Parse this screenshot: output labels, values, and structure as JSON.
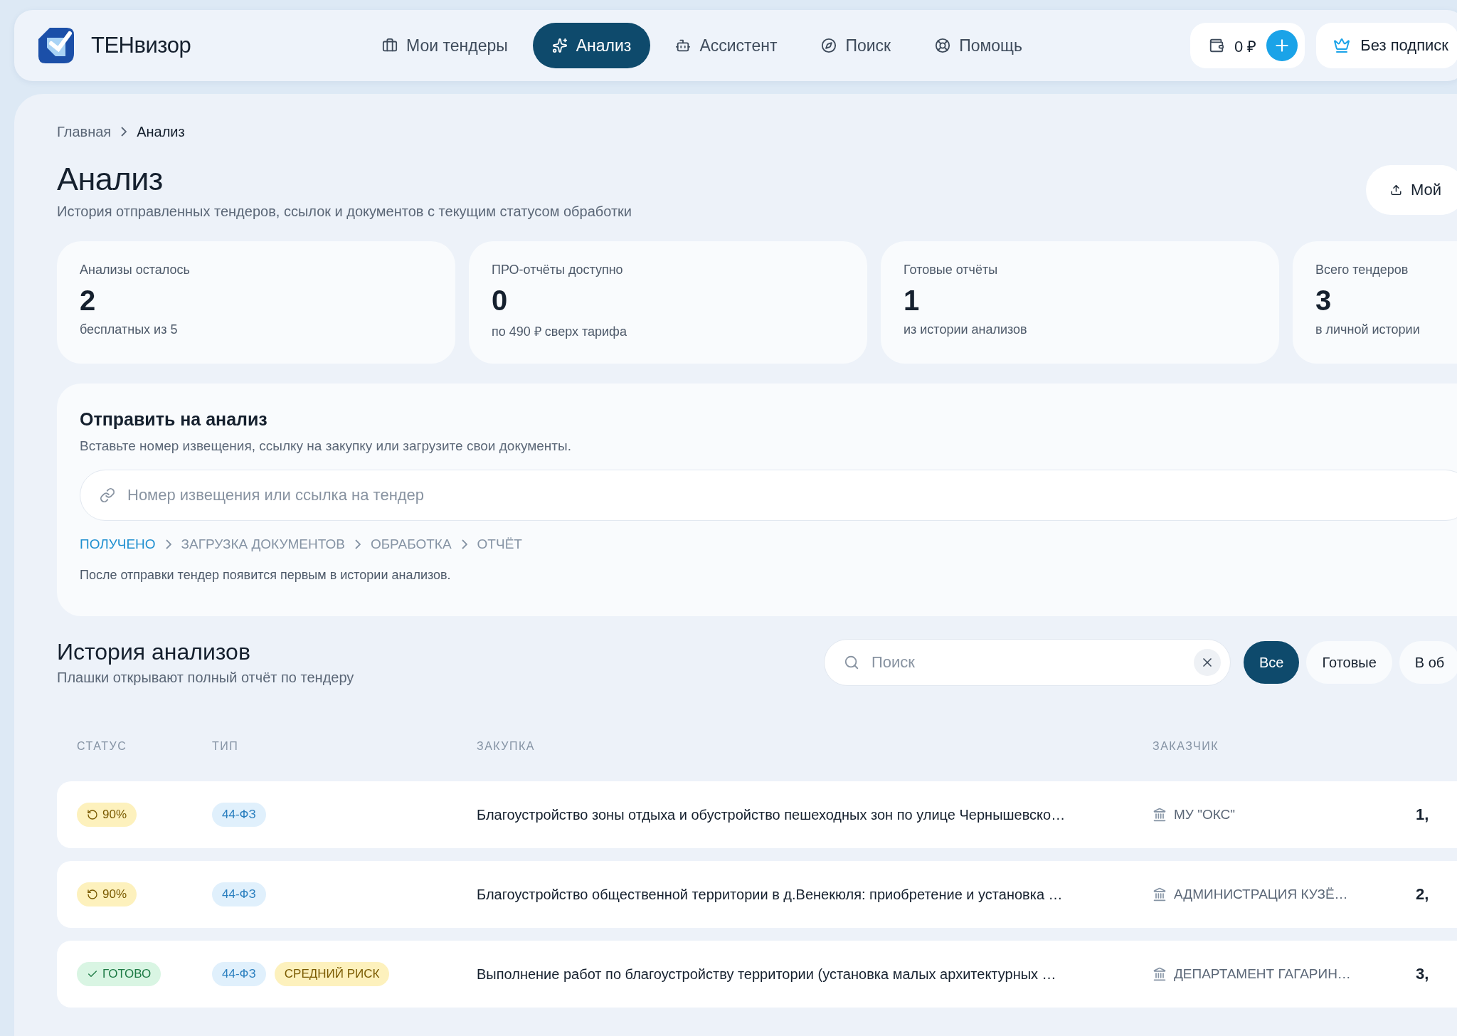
{
  "brand": {
    "name": "ТЕНвизор"
  },
  "nav": [
    {
      "label": "Мои тендеры",
      "selected": false
    },
    {
      "label": "Анализ",
      "selected": true
    },
    {
      "label": "Ассистент",
      "selected": false
    },
    {
      "label": "Поиск",
      "selected": false
    },
    {
      "label": "Помощь",
      "selected": false
    }
  ],
  "wallet": {
    "balance": "0 ₽"
  },
  "subscription": {
    "label": "Без подписк"
  },
  "breadcrumbs": [
    {
      "label": "Главная",
      "current": false
    },
    {
      "label": "Анализ",
      "current": true
    }
  ],
  "page": {
    "title": "Анализ",
    "subtitle": "История отправленных тендеров, ссылок и документов с текущим статусом обработки",
    "action": "Мой"
  },
  "stats": [
    {
      "label": "Анализы осталось",
      "value": "2",
      "note": "бесплатных из 5"
    },
    {
      "label": "ПРО-отчёты доступно",
      "value": "0",
      "note": "по 490 ₽ сверх тарифа"
    },
    {
      "label": "Готовые отчёты",
      "value": "1",
      "note": "из истории анализов"
    },
    {
      "label": "Всего тендеров",
      "value": "3",
      "note": "в личной истории"
    }
  ],
  "submit": {
    "title": "Отправить на анализ",
    "hint": "Вставьте номер извещения, ссылку на закупку или загрузите свои документы.",
    "placeholder": "Номер извещения или ссылка на тендер",
    "steps": [
      {
        "label": "ПОЛУЧЕНО",
        "active": true
      },
      {
        "label": "ЗАГРУЗКА ДОКУМЕНТОВ",
        "active": false
      },
      {
        "label": "ОБРАБОТКА",
        "active": false
      },
      {
        "label": "ОТЧЁТ",
        "active": false
      }
    ],
    "note": "После отправки тендер появится первым в истории анализов."
  },
  "history": {
    "title": "История анализов",
    "subtitle": "Плашки открывают полный отчёт по тендеру",
    "search_placeholder": "Поиск",
    "filters": [
      {
        "label": "Все",
        "selected": true
      },
      {
        "label": "Готовые",
        "selected": false
      },
      {
        "label": "В об",
        "selected": false
      }
    ],
    "columns": [
      "СТАТУС",
      "ТИП",
      "ЗАКУПКА",
      "ЗАКАЗЧИК"
    ],
    "rows": [
      {
        "status": {
          "kind": "progress",
          "label": "90%"
        },
        "tags": [
          {
            "kind": "law",
            "label": "44-ФЗ"
          }
        ],
        "purchase": "Благоустройство зоны отдыха и обустройство пешеходных зон по улице Чернышевско…",
        "customer": "МУ \"ОКС\"",
        "column_5": "1,"
      },
      {
        "status": {
          "kind": "progress",
          "label": "90%"
        },
        "tags": [
          {
            "kind": "law",
            "label": "44-ФЗ"
          }
        ],
        "purchase": "Благоустройство общественной территории в д.Венекюля: приобретение и установка …",
        "customer": "АДМИНИСТРАЦИЯ КУЗЁ…",
        "column_5": "2,"
      },
      {
        "status": {
          "kind": "done",
          "label": "ГОТОВО"
        },
        "tags": [
          {
            "kind": "law",
            "label": "44-ФЗ"
          },
          {
            "kind": "risk",
            "label": "СРЕДНИЙ РИСК"
          }
        ],
        "purchase": "Выполнение работ по благоустройству территории (установка малых архитектурных …",
        "customer": "ДЕПАРТАМЕНТ ГАГАРИН…",
        "column_5": "3,"
      }
    ]
  }
}
